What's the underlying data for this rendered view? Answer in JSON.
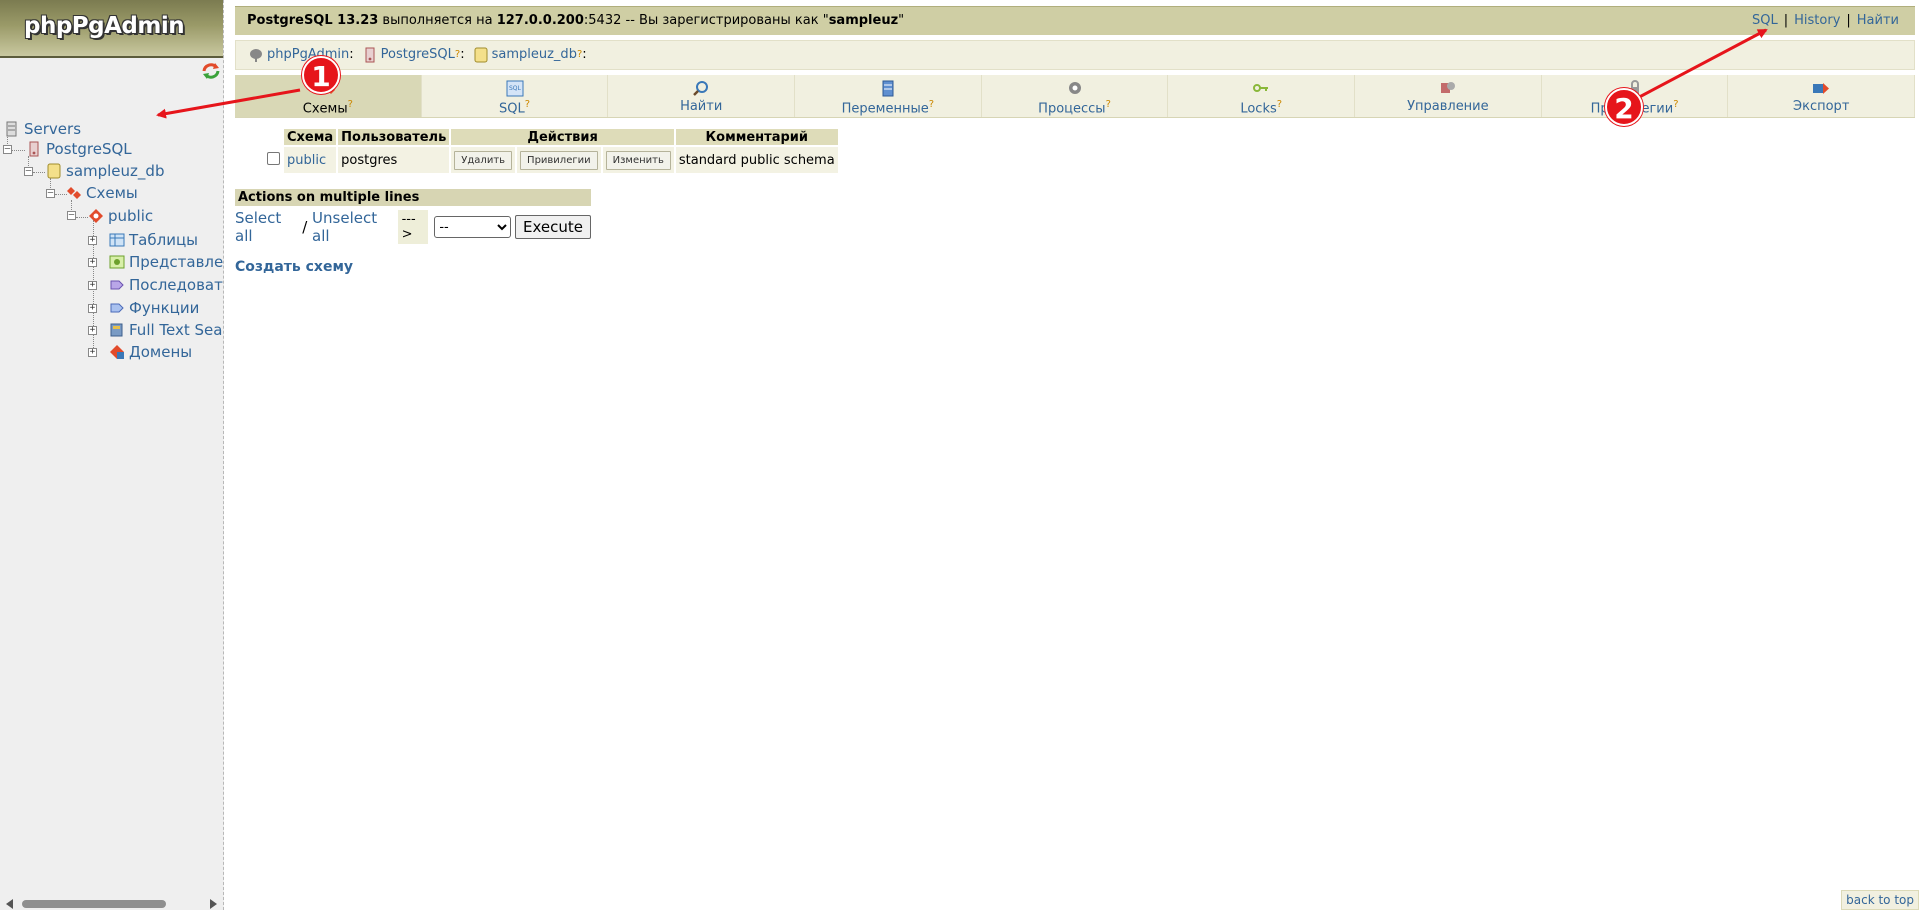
{
  "logo": {
    "text": "phpPgAdmin"
  },
  "sidebar": {
    "servers": "Servers",
    "server": "PostgreSQL",
    "database": "sampleuz_db",
    "schemas": "Схемы",
    "schema": "public",
    "items": [
      "Таблицы",
      "Представления",
      "Последовательности",
      "Функции",
      "Full Text Search",
      "Домены"
    ]
  },
  "topbar": {
    "product": "PostgreSQL 13.23",
    "running_on": " выполняется на ",
    "host": "127.0.0.200",
    "port": ":5432",
    "logged_as": " -- Вы зарегистрированы как \"",
    "user": "sampleuz",
    "quote_end": "\"",
    "links": {
      "sql": "SQL",
      "history": "History",
      "find": "Найти"
    }
  },
  "trail": {
    "app": "phpPgAdmin",
    "server": "PostgreSQL",
    "database": "sampleuz_db",
    "q": "?",
    "colon": ":"
  },
  "tabs": [
    {
      "label": "Схемы",
      "help": "?",
      "icon": "schema-icon"
    },
    {
      "label": "SQL",
      "help": "?",
      "icon": "sql-icon"
    },
    {
      "label": "Найти",
      "help": "",
      "icon": "search-icon"
    },
    {
      "label": "Переменные",
      "help": "?",
      "icon": "variables-icon"
    },
    {
      "label": "Процессы",
      "help": "?",
      "icon": "processes-icon"
    },
    {
      "label": "Locks",
      "help": "?",
      "icon": "locks-icon"
    },
    {
      "label": "Управление",
      "help": "",
      "icon": "admin-icon"
    },
    {
      "label": "Привилегии",
      "help": "?",
      "icon": "privileges-icon"
    },
    {
      "label": "Экспорт",
      "help": "",
      "icon": "export-icon"
    }
  ],
  "schema_table": {
    "headers": {
      "schema": "Схема",
      "owner": "Пользователь",
      "actions": "Действия",
      "comment": "Комментарий"
    },
    "rows": [
      {
        "schema": "public",
        "owner": "postgres",
        "btn_drop": "Удалить",
        "btn_privileges": "Привилегии",
        "btn_alter": "Изменить",
        "comment": "standard public schema"
      }
    ]
  },
  "multi": {
    "title": "Actions on multiple lines",
    "select_all": "Select all",
    "slash": " / ",
    "unselect_all": "Unselect all",
    "arrow": "--->",
    "select_value": "--",
    "execute": "Execute"
  },
  "create_schema": "Создать схему",
  "back_to_top": "back to top",
  "annotations": {
    "one": "1",
    "two": "2",
    "color": "#e6151b"
  }
}
